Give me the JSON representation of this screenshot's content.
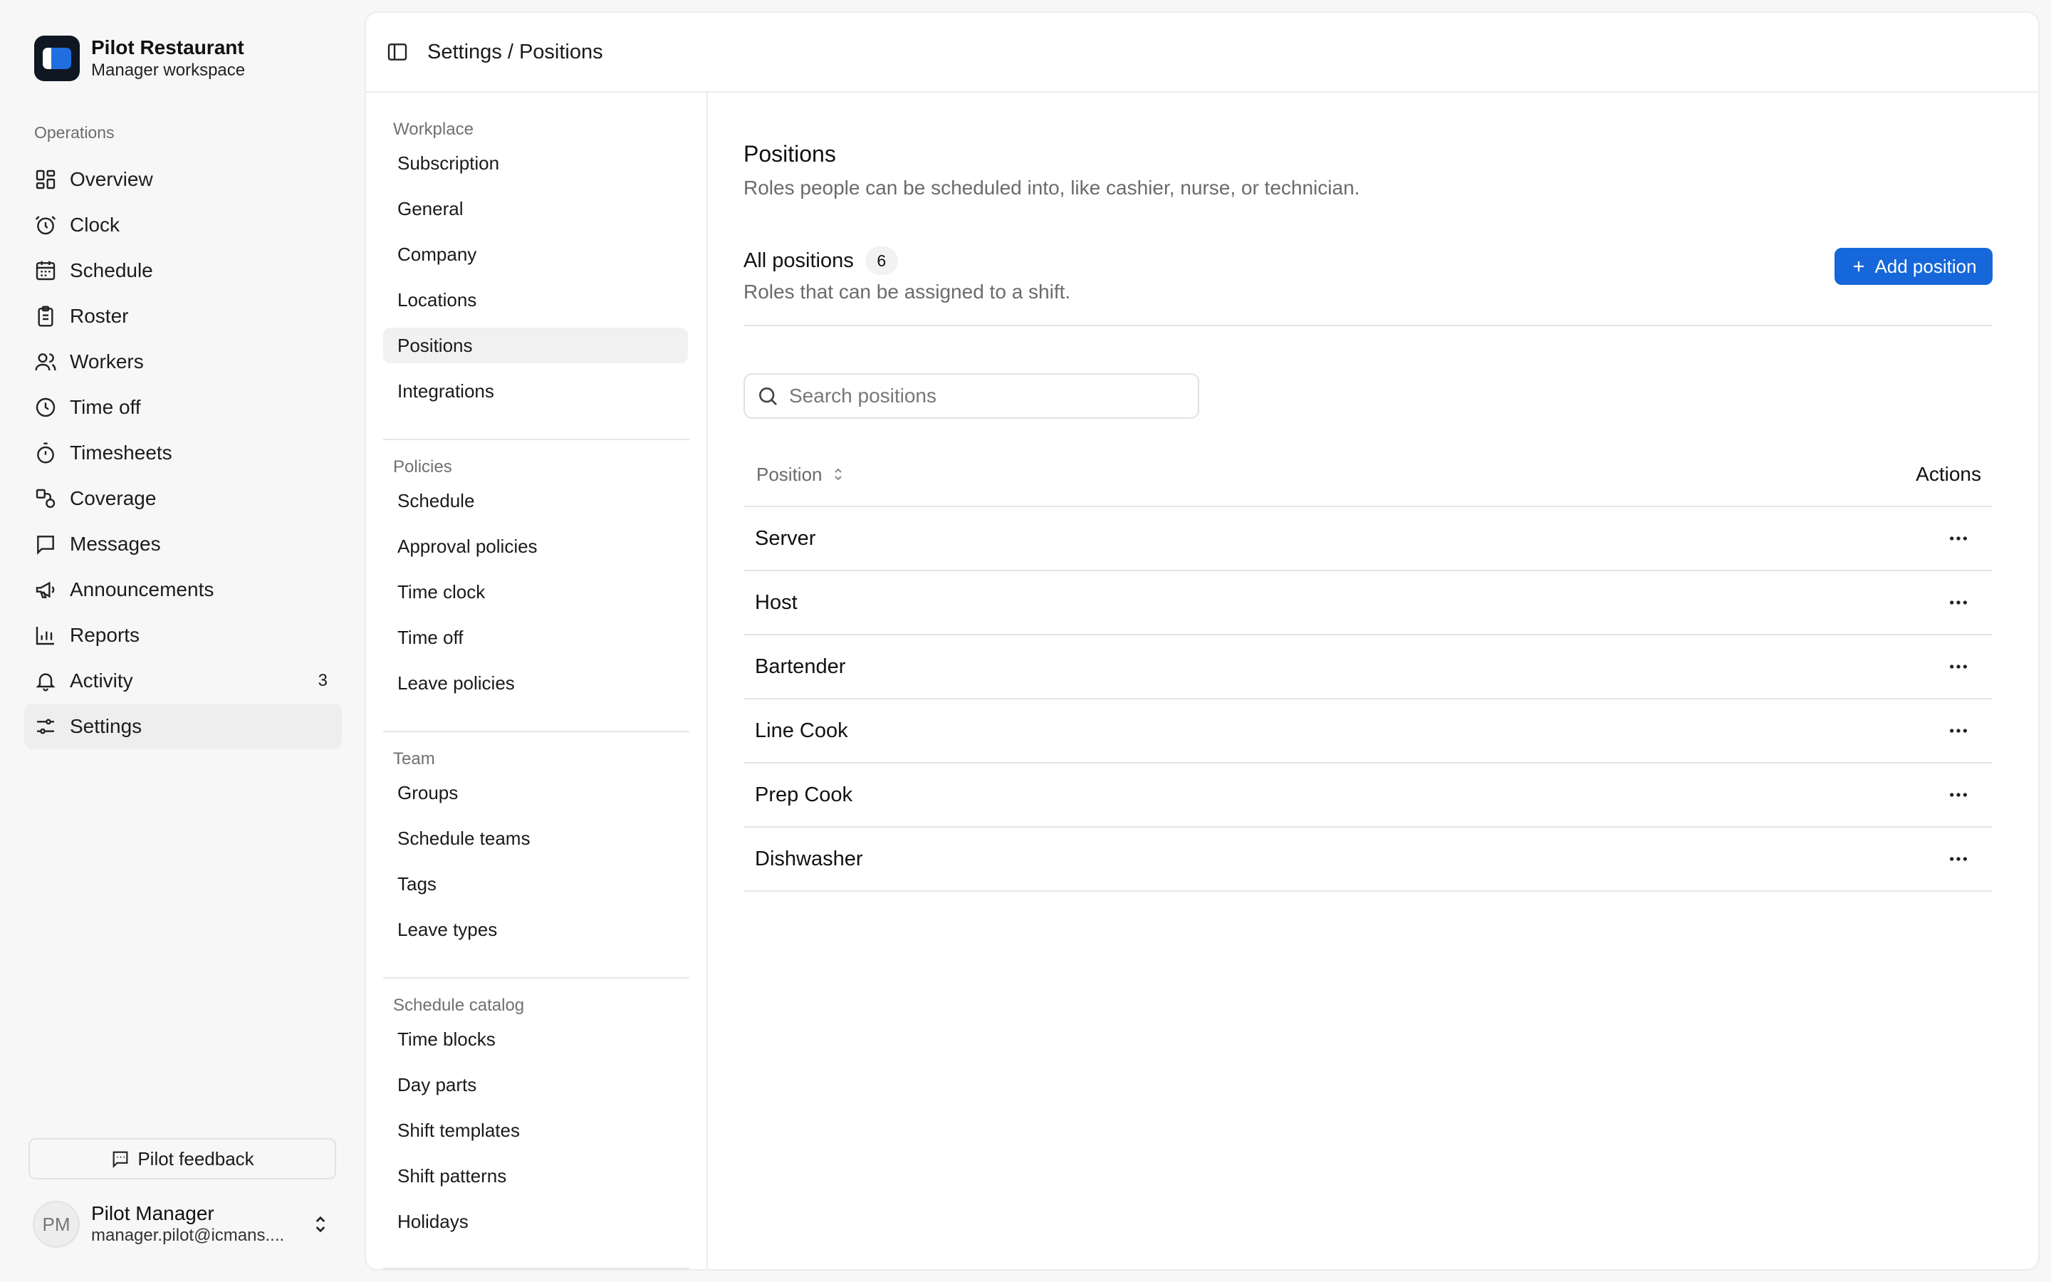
{
  "brand": {
    "name": "Pilot Restaurant",
    "subtitle": "Manager workspace"
  },
  "sidebar": {
    "section_label": "Operations",
    "items": [
      {
        "label": "Overview",
        "icon": "grid-icon"
      },
      {
        "label": "Clock",
        "icon": "alarm-clock-icon"
      },
      {
        "label": "Schedule",
        "icon": "calendar-icon"
      },
      {
        "label": "Roster",
        "icon": "clipboard-icon"
      },
      {
        "label": "Workers",
        "icon": "users-icon"
      },
      {
        "label": "Time off",
        "icon": "clock-icon"
      },
      {
        "label": "Timesheets",
        "icon": "stopwatch-icon"
      },
      {
        "label": "Coverage",
        "icon": "coverage-icon"
      },
      {
        "label": "Messages",
        "icon": "message-icon"
      },
      {
        "label": "Announcements",
        "icon": "megaphone-icon"
      },
      {
        "label": "Reports",
        "icon": "bar-chart-icon"
      },
      {
        "label": "Activity",
        "icon": "bell-icon",
        "badge": "3"
      },
      {
        "label": "Settings",
        "icon": "sliders-icon",
        "active": true
      }
    ],
    "feedback_label": "Pilot feedback",
    "user": {
      "initials": "PM",
      "name": "Pilot Manager",
      "email": "manager.pilot@icmans...."
    }
  },
  "topbar": {
    "breadcrumb": "Settings / Positions"
  },
  "settings_nav": {
    "groups": [
      {
        "label": "Workplace",
        "items": [
          "Subscription",
          "General",
          "Company",
          "Locations",
          "Positions",
          "Integrations"
        ]
      },
      {
        "label": "Policies",
        "items": [
          "Schedule",
          "Approval policies",
          "Time clock",
          "Time off",
          "Leave policies"
        ]
      },
      {
        "label": "Team",
        "items": [
          "Groups",
          "Schedule teams",
          "Tags",
          "Leave types"
        ]
      },
      {
        "label": "Schedule catalog",
        "items": [
          "Time blocks",
          "Day parts",
          "Shift templates",
          "Shift patterns",
          "Holidays"
        ]
      }
    ],
    "active_item": "Positions"
  },
  "content": {
    "title": "Positions",
    "description": "Roles people can be scheduled into, like cashier, nurse, or technician.",
    "list_title": "All positions",
    "count": "6",
    "list_description": "Roles that can be assigned to a shift.",
    "add_button": "Add position",
    "search_placeholder": "Search positions",
    "table": {
      "col_position": "Position",
      "col_actions": "Actions",
      "rows": [
        "Server",
        "Host",
        "Bartender",
        "Line Cook",
        "Prep Cook",
        "Dishwasher"
      ]
    }
  },
  "colors": {
    "accent": "#1667d9",
    "brand_dark": "#0f1722",
    "active_bg": "#eeeeef"
  }
}
